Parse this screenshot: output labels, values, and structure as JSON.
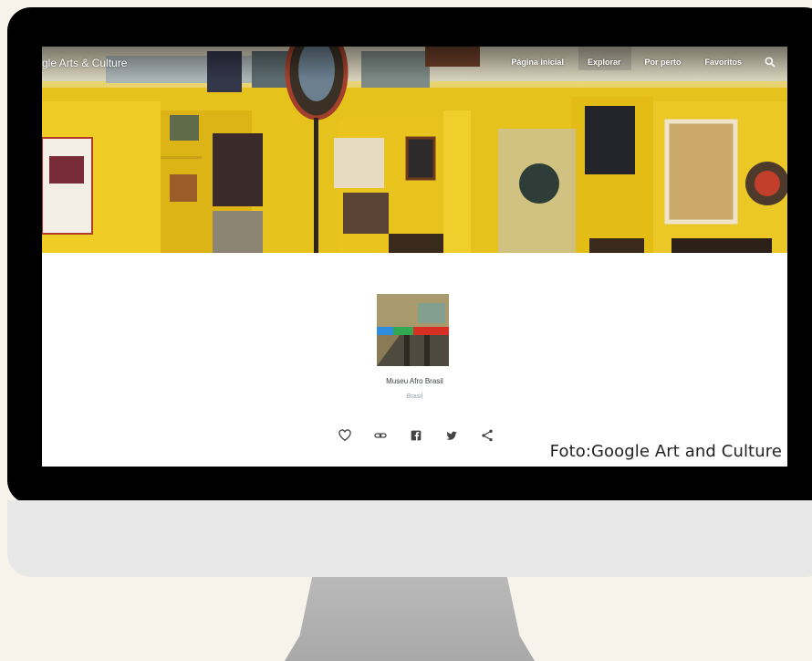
{
  "header": {
    "brand": "gle Arts & Culture",
    "nav": [
      {
        "label": "Página inicial"
      },
      {
        "label": "Explorar"
      },
      {
        "label": "Por perto"
      },
      {
        "label": "Favoritos"
      }
    ],
    "search_icon": "search-icon"
  },
  "museum": {
    "name": "Museu Afro Brasil",
    "country": "Brasil",
    "actions": [
      "heart-icon",
      "link-icon",
      "facebook-icon",
      "twitter-icon",
      "share-icon"
    ]
  },
  "caption": "Foto:Google Art and Culture",
  "colors": {
    "bezel": "#000000",
    "chin": "#e8e8e8",
    "stand": "#b2b2b2",
    "background": "#f8f3ea",
    "hero_yellow": "#e6c21d"
  }
}
